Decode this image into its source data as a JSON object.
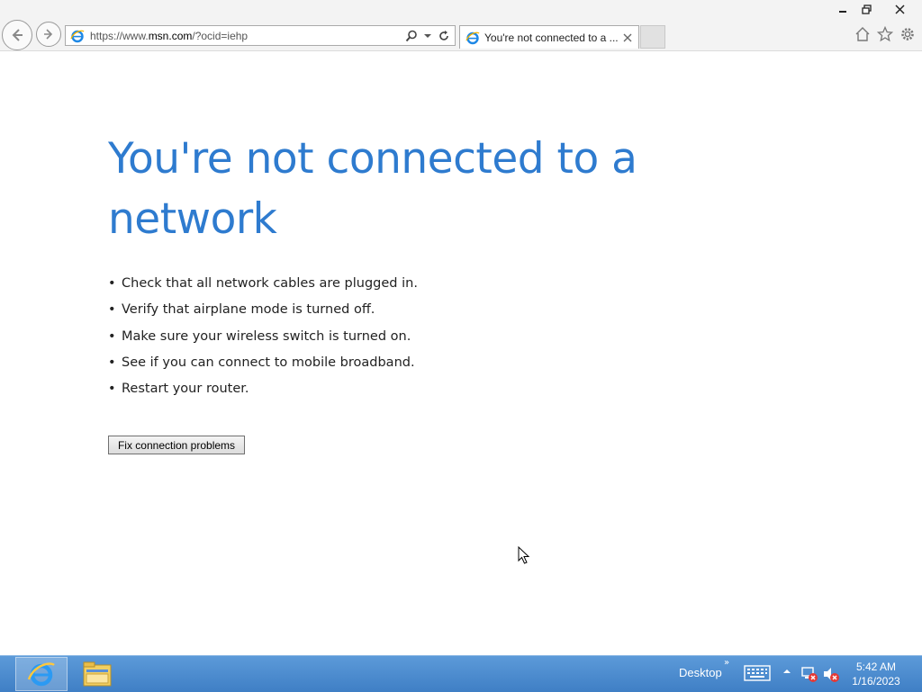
{
  "browser": {
    "address_url_prefix": "https://www.",
    "address_url_domain": "msn.com",
    "address_url_rest": "/?ocid=iehp",
    "tab_title": "You're not connected to a ...",
    "icons": [
      "back-arrow-icon",
      "forward-arrow-icon",
      "ie-favicon-icon",
      "search-icon",
      "dropdown-arrow-icon",
      "refresh-icon",
      "close-tab-icon",
      "home-icon",
      "favorites-star-icon",
      "settings-gear-icon",
      "minimize-icon",
      "restore-icon",
      "close-window-icon"
    ]
  },
  "page": {
    "headline": "You're not connected to a network",
    "bullets": [
      "Check that all network cables are plugged in.",
      "Verify that airplane mode is turned off.",
      "Make sure your wireless switch is turned on.",
      "See if you can connect to mobile broadband.",
      "Restart your router."
    ],
    "bullet_char": "•",
    "fix_button_label": "Fix connection problems",
    "headline_color": "#2e7bcf"
  },
  "taskbar": {
    "desktop_label": "Desktop",
    "desktop_chevron": "»",
    "clock_time": "5:42 AM",
    "clock_date": "1/16/2023",
    "icons": [
      "internet-explorer-icon",
      "file-explorer-icon",
      "keyboard-icon",
      "show-hidden-icons-icon",
      "network-disconnected-icon",
      "volume-muted-icon"
    ]
  }
}
